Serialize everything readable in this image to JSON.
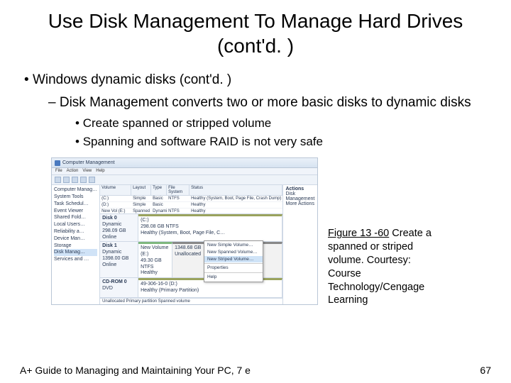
{
  "title": "Use Disk Management To Manage Hard Drives (cont'd. )",
  "bullets": {
    "l1": "Windows dynamic disks (cont'd. )",
    "l2": "Disk Management converts two or more basic disks to dynamic disks",
    "l3a": "Create spanned or stripped volume",
    "l3b": "Spanning and software RAID is not very safe"
  },
  "screenshot": {
    "window_title": "Computer Management",
    "menu": [
      "File",
      "Action",
      "View",
      "Help"
    ],
    "tree": [
      "Computer Manag…",
      " System Tools",
      "  Task Schedul…",
      "  Event Viewer",
      "  Shared Fold…",
      "  Local Users…",
      "  Reliability a…",
      "  Device Man…",
      " Storage",
      "  Disk Manag…",
      " Services and …"
    ],
    "tree_selected_index": 9,
    "cols": [
      "Volume",
      "Layout",
      "Type",
      "File System",
      "Status"
    ],
    "rows": [
      [
        "(C:)",
        "Simple",
        "Basic",
        "NTFS",
        "Healthy (System, Boot, Page File, Crash Dump)"
      ],
      [
        "(D:)",
        "Simple",
        "Basic",
        "",
        "Healthy"
      ],
      [
        "New Vol (E:)",
        "Spanned",
        "Dynamic",
        "NTFS",
        "Healthy"
      ]
    ],
    "disks": [
      {
        "name": "Disk 0",
        "type": "Dynamic",
        "size": "298.09 GB",
        "status": "Online",
        "parts": [
          {
            "title": "(C:)",
            "sub": "298.08 GB NTFS",
            "status": "Healthy (System, Boot, Page File, C…",
            "style": "olive"
          }
        ]
      },
      {
        "name": "Disk 1",
        "type": "Dynamic",
        "size": "1398.00 GB",
        "status": "Online",
        "parts": [
          {
            "title": "New Volume (E:)",
            "sub": "49.30 GB NTFS",
            "status": "Healthy",
            "style": "green"
          },
          {
            "title": "",
            "sub": "1348.68 GB",
            "status": "Unallocated",
            "style": "gray"
          }
        ]
      },
      {
        "name": "CD-ROM 0",
        "type": "DVD",
        "size": "",
        "status": "",
        "parts": [
          {
            "title": "(D:)",
            "sub": "49-306-16-0 (D:)",
            "status": "Healthy (Primary Partition)",
            "style": "olive"
          }
        ]
      }
    ],
    "legend": "Unallocated   Primary partition   Spanned volume",
    "context_menu": [
      "New Simple Volume…",
      "New Spanned Volume…",
      "New Striped Volume…",
      "Properties",
      "Help"
    ],
    "context_hover_index": 2,
    "actions_pane": {
      "title": "Actions",
      "items": [
        "Disk Management",
        "More Actions"
      ]
    }
  },
  "caption": {
    "label": "Figure 13 -60",
    "text": " Create a spanned or striped volume. Courtesy: Course Technology/Cengage Learning"
  },
  "footer": "A+ Guide to Managing and Maintaining Your PC, 7 e",
  "page_number": "67"
}
